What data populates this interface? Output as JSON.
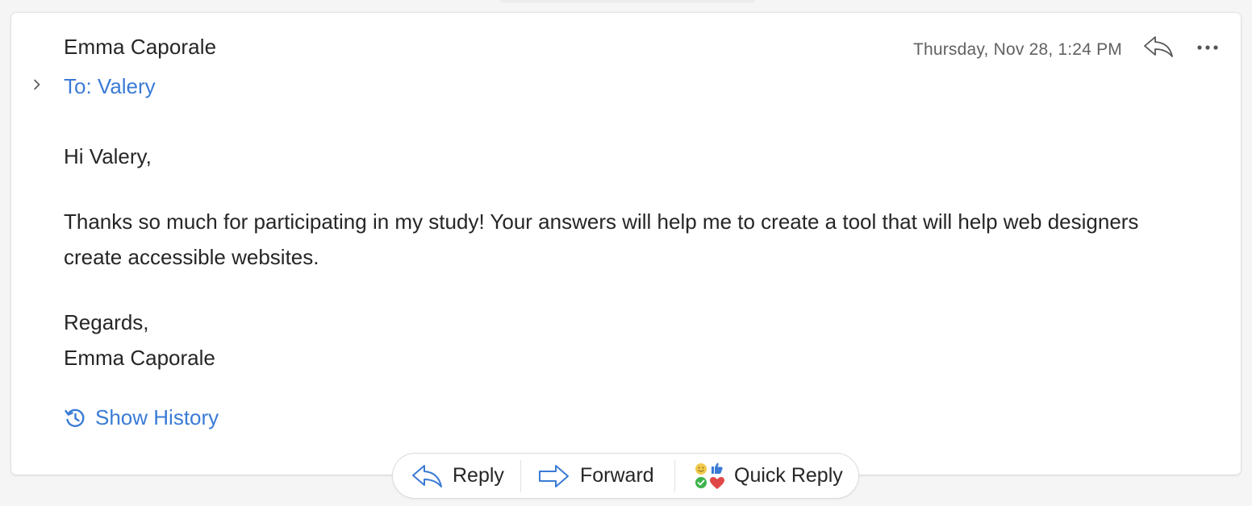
{
  "email": {
    "sender": "Emma Caporale",
    "recipients": "To: Valery",
    "timestamp": "Thursday, Nov 28, 1:24 PM",
    "body": {
      "greeting": "Hi Valery,",
      "message": "Thanks so much for participating in my study! Your answers will help me to create a tool that will help web designers create accessible websites.",
      "closing": "Regards,",
      "signature": "Emma Caporale"
    },
    "show_history_label": "Show History"
  },
  "actions": {
    "reply_label": "Reply",
    "forward_label": "Forward",
    "quick_reply_label": "Quick Reply"
  },
  "icons": {
    "expander": "chevron-right-icon",
    "header_reply": "reply-arrow-icon",
    "header_more": "more-horizontal-icon",
    "history": "history-icon",
    "reply": "reply-arrow-icon",
    "forward": "forward-arrow-icon",
    "quick_reply": "reactions-icon"
  },
  "colors": {
    "accent_blue": "#3a7bd5",
    "text": "#262626",
    "muted": "#616161"
  }
}
